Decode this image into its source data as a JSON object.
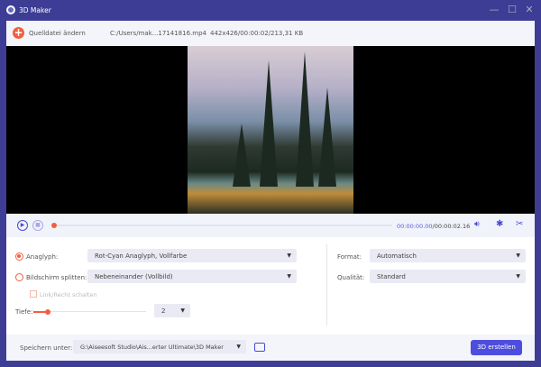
{
  "window": {
    "title": "3D Maker",
    "minimize": "—",
    "maximize": "☐",
    "close": "✕"
  },
  "topbar": {
    "add_label": "Quelldatei ändern",
    "file_path": "C:/Users/mak...17141816.mp4",
    "file_info": "442x426/00:00:02/213,31 KB"
  },
  "player": {
    "current_time": "00:00:00.00",
    "total_time": "/00:00:02.16",
    "progress": 0
  },
  "settings": {
    "anaglyph_label": "Anaglyph:",
    "anaglyph_value": "Rot-Cyan Anaglyph, Vollfarbe",
    "anaglyph_selected": true,
    "split_label": "Bildschirm splitten:",
    "split_value": "Nebeneinander (Vollbild)",
    "split_selected": false,
    "swap_label": "Link/Recht schalten",
    "depth_label": "Tiefe:",
    "depth_value": "2",
    "format_label": "Format:",
    "format_value": "Automatisch",
    "quality_label": "Qualität:",
    "quality_value": "Standard"
  },
  "footer": {
    "save_label": "Speichern unter:",
    "save_path": "G:\\Aiseesoft Studio\\Ais...erter Ultimate\\3D Maker",
    "create_label": "3D erstellen"
  },
  "colors": {
    "accent": "#4d4de0",
    "orange": "#f0603e",
    "frame": "#3d3d96"
  }
}
